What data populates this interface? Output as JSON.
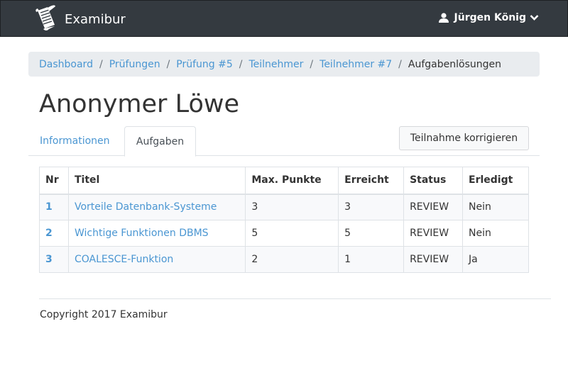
{
  "app": {
    "name": "Examibur",
    "logo_icon": "scroll-feather-icon"
  },
  "user": {
    "name": "Jürgen König",
    "icon": "user-icon",
    "dropdown_icon": "chevron-down-icon"
  },
  "breadcrumb": {
    "items": [
      {
        "label": "Dashboard"
      },
      {
        "label": "Prüfungen"
      },
      {
        "label": "Prüfung #5"
      },
      {
        "label": "Teilnehmer"
      },
      {
        "label": "Teilnehmer #7"
      }
    ],
    "separator": "/",
    "current": "Aufgabenlösungen"
  },
  "page": {
    "title": "Anonymer Löwe"
  },
  "tabs": [
    {
      "label": "Informationen",
      "active": false
    },
    {
      "label": "Aufgaben",
      "active": true
    }
  ],
  "actions": {
    "correct_label": "Teilnahme korrigieren"
  },
  "table": {
    "columns": [
      "Nr",
      "Titel",
      "Max. Punkte",
      "Erreicht",
      "Status",
      "Erledigt"
    ],
    "rows": [
      {
        "nr": "1",
        "title": "Vorteile Datenbank-Systeme",
        "max": "3",
        "reached": "3",
        "status": "REVIEW",
        "done": "Nein"
      },
      {
        "nr": "2",
        "title": "Wichtige Funktionen DBMS",
        "max": "5",
        "reached": "5",
        "status": "REVIEW",
        "done": "Nein"
      },
      {
        "nr": "3",
        "title": "COALESCE-Funktion",
        "max": "2",
        "reached": "1",
        "status": "REVIEW",
        "done": "Ja"
      }
    ]
  },
  "footer": {
    "text": "Copyright 2017 Examibur"
  },
  "colors": {
    "navbar": "#343a40",
    "link": "#4a96d2",
    "breadcrumb_bg": "#e9ecef"
  }
}
